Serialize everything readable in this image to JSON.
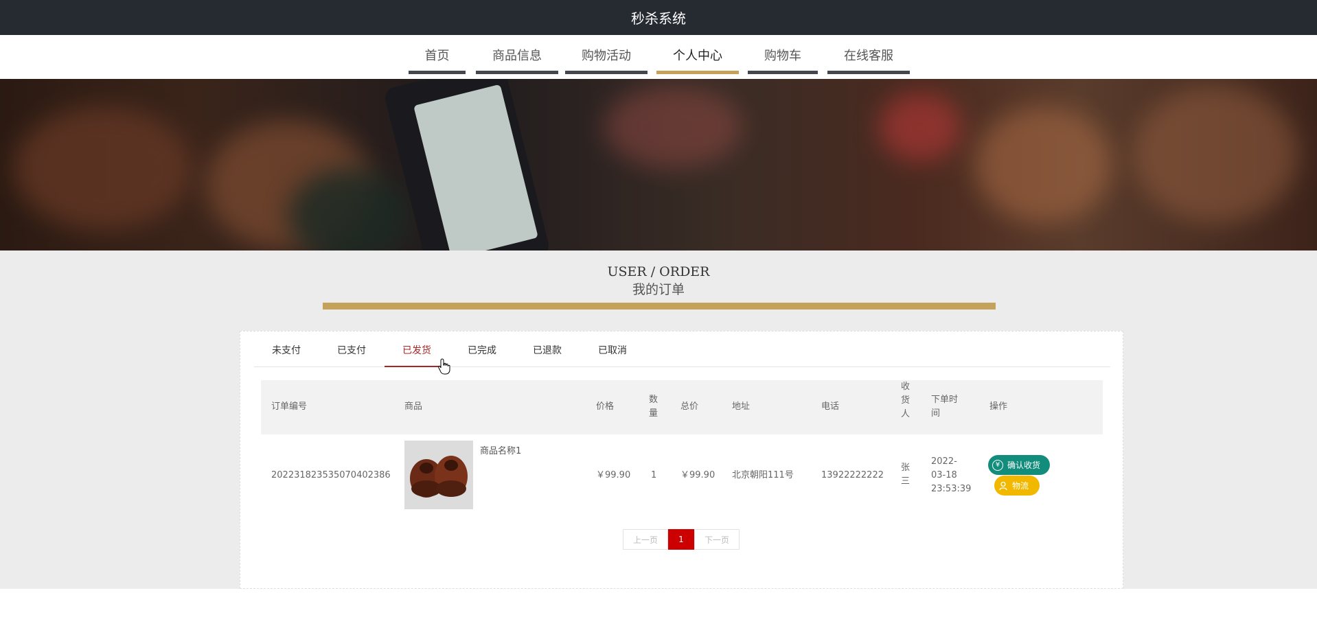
{
  "header": {
    "title": "秒杀系统"
  },
  "nav": {
    "items": [
      {
        "label": "首页"
      },
      {
        "label": "商品信息"
      },
      {
        "label": "购物活动"
      },
      {
        "label": "个人中心"
      },
      {
        "label": "购物车"
      },
      {
        "label": "在线客服"
      }
    ],
    "active_index": 3
  },
  "section": {
    "title_en": "USER / ORDER",
    "title_cn": "我的订单"
  },
  "tabs": {
    "items": [
      {
        "label": "未支付"
      },
      {
        "label": "已支付"
      },
      {
        "label": "已发货"
      },
      {
        "label": "已完成"
      },
      {
        "label": "已退款"
      },
      {
        "label": "已取消"
      }
    ],
    "active_index": 2
  },
  "table": {
    "headers": {
      "order_no": "订单编号",
      "product": "商品",
      "price": "价格",
      "qty_1": "数",
      "qty_2": "量",
      "total": "总价",
      "address": "地址",
      "phone": "电话",
      "receiver_1": "收",
      "receiver_2": "货",
      "receiver_3": "人",
      "time_1": "下单时",
      "time_2": "间",
      "action": "操作"
    },
    "rows": [
      {
        "order_no": "202231823535070402386",
        "product_name": "商品名称1",
        "price": "￥99.90",
        "qty": "1",
        "total": "￥99.90",
        "address": "北京朝阳111号",
        "phone": "13922222222",
        "receiver_1": "张",
        "receiver_2": "三",
        "time_1": "2022-",
        "time_2": "03-18",
        "time_3": "23:53:39",
        "confirm_label": "确认收货",
        "logistics_label": "物流"
      }
    ]
  },
  "pager": {
    "prev": "上一页",
    "current": "1",
    "next": "下一页"
  },
  "colors": {
    "topbar": "#262a31",
    "accent_gold": "#c4a25a",
    "active_tab": "#a92525",
    "confirm_btn": "#128d7c",
    "logistics_btn": "#f2b800",
    "pager_current": "#cc0000"
  }
}
